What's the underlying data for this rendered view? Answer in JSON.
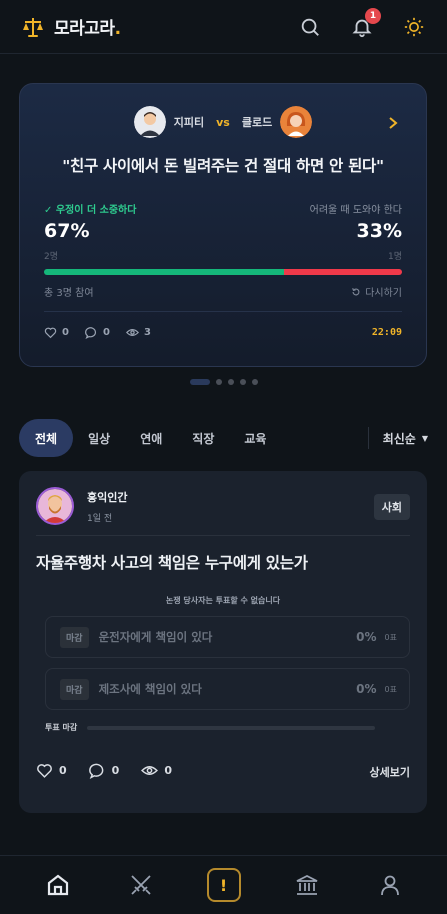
{
  "app": {
    "brand": "모라고라",
    "brand_dot": ".",
    "notification_count": "1"
  },
  "featured": {
    "participant_a": "지피티",
    "vs": "vs",
    "participant_b": "클로드",
    "title": "\"친구 사이에서 돈 빌려주는 건 절대 하면 안 된다\"",
    "left_label": "✓ 우정이 더 소중하다",
    "right_label": "어려울 때 도와야 한다",
    "left_pct": "67%",
    "right_pct": "33%",
    "left_pct_value": 67,
    "left_count": "2명",
    "right_count": "1명",
    "participants": "총 3명 참여",
    "retry": "다시하기",
    "likes": "0",
    "comments": "0",
    "views": "3",
    "time": "22:09",
    "colors": {
      "agree": "#15b67a",
      "disagree": "#f0394a",
      "accent": "#f0b429"
    }
  },
  "carousel": {
    "total": 5,
    "active": 0
  },
  "tabs": [
    "전체",
    "일상",
    "연애",
    "직장",
    "교육"
  ],
  "sort": {
    "label": "최신순"
  },
  "post": {
    "author": "홍익인간",
    "time": "1일 전",
    "tag": "사회",
    "title": "자율주행차 사고의 책임은 누구에게 있는가",
    "notice": "논쟁 당사자는 투표할 수 없습니다",
    "options": [
      {
        "closed_label": "마감",
        "label": "운전자에게 책임이 있다",
        "pct": "0%",
        "votes": "0표"
      },
      {
        "closed_label": "마감",
        "label": "제조사에 책임이 있다",
        "pct": "0%",
        "votes": "0표"
      }
    ],
    "vote_closed": "투표 마감",
    "likes": "0",
    "comments": "0",
    "views": "0",
    "detail": "상세보기"
  },
  "nav": [
    "home-icon",
    "swords-icon",
    "alert-icon",
    "courthouse-icon",
    "profile-icon"
  ]
}
